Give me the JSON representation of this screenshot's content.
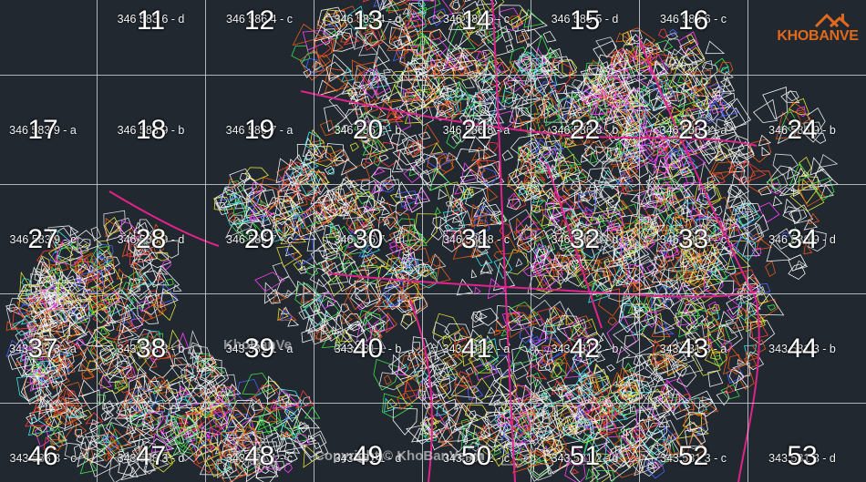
{
  "colors": {
    "background": "#212830",
    "grid": "#c9cdd2",
    "parcel_lines": [
      "#f0f0f0",
      "#d9d9d9",
      "#e85a16",
      "#e0e238",
      "#ff3fff",
      "#3fe24a",
      "#ff3b3b",
      "#3fe6e6",
      "#4d63ff",
      "#ffffff"
    ],
    "major_roads": "#e0238c",
    "logo_accent": "#e06a1c"
  },
  "logo": {
    "text": "KHOBANVE",
    "icon": "house-roof-icon"
  },
  "watermarks": {
    "cell_text": "KhoBanVe",
    "copyright": "Copyright © KhoBanVe.vn"
  },
  "sheets": [
    {
      "num": "11",
      "code": "346 583 6 - d"
    },
    {
      "num": "12",
      "code": "346 586 4 - c"
    },
    {
      "num": "13",
      "code": "346 583 4 - d"
    },
    {
      "num": "14",
      "code": "346 586 5 - c"
    },
    {
      "num": "15",
      "code": "346 586 5 - d"
    },
    {
      "num": "16",
      "code": "346 586 6 - c"
    },
    {
      "num": "17",
      "code": "346 583 9 - a"
    },
    {
      "num": "18",
      "code": "346 583 9 - b"
    },
    {
      "num": "19",
      "code": "346 586 7 - a"
    },
    {
      "num": "20",
      "code": "346 586 7 - b"
    },
    {
      "num": "21",
      "code": "346 586 8 - a"
    },
    {
      "num": "22",
      "code": "346 586 8 - b"
    },
    {
      "num": "23",
      "code": "346 586 9 - a"
    },
    {
      "num": "24",
      "code": "346 586 9 - b"
    },
    {
      "num": "27",
      "code": "346 583 9 - c"
    },
    {
      "num": "28",
      "code": "346 583 9 - d"
    },
    {
      "num": "29",
      "code": "346 586 7 - c"
    },
    {
      "num": "30",
      "code": "346 586 7 - d"
    },
    {
      "num": "31",
      "code": "346 586 8 - c"
    },
    {
      "num": "32",
      "code": "346 586 8 - d"
    },
    {
      "num": "33",
      "code": "346 586 9 - c"
    },
    {
      "num": "34",
      "code": "346 586 9 - d"
    },
    {
      "num": "37",
      "code": "343 583 3 - a"
    },
    {
      "num": "38",
      "code": "343 583 3 - b"
    },
    {
      "num": "39",
      "code": "343 581 1 - a"
    },
    {
      "num": "40",
      "code": "343 581 1 - b"
    },
    {
      "num": "41",
      "code": "343 581 2 - a"
    },
    {
      "num": "42",
      "code": "343 581 2 - b"
    },
    {
      "num": "43",
      "code": "343 581 3 - a"
    },
    {
      "num": "44",
      "code": "343 581 3 - b"
    },
    {
      "num": "46",
      "code": "343 583 3 - c"
    },
    {
      "num": "47",
      "code": "343 583 3 - d"
    },
    {
      "num": "48",
      "code": "343 581 1 - c"
    },
    {
      "num": "49",
      "code": "343 581 1 - d"
    },
    {
      "num": "50",
      "code": "343 581 2 - c"
    },
    {
      "num": "51",
      "code": "343 581 2 - d"
    },
    {
      "num": "52",
      "code": "343 581 3 - c"
    },
    {
      "num": "53",
      "code": "343 581 3 - d"
    }
  ]
}
